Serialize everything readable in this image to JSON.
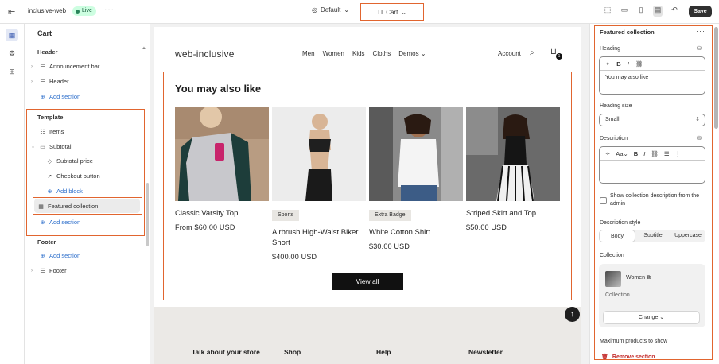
{
  "topbar": {
    "store_name": "inclusive-web",
    "live_label": "Live",
    "theme_label": "Default",
    "page_label": "Cart",
    "save_label": "Save"
  },
  "left_panel": {
    "title": "Cart",
    "header_group": "Header",
    "announcement_bar": "Announcement bar",
    "header_item": "Header",
    "add_section": "Add section",
    "template_group": "Template",
    "items": "Items",
    "subtotal": "Subtotal",
    "subtotal_price": "Subtotal price",
    "checkout_button": "Checkout button",
    "add_block": "Add block",
    "featured_collection": "Featured collection",
    "footer_group": "Footer",
    "footer_item": "Footer"
  },
  "storefront": {
    "logo": "web-inclusive",
    "nav": [
      "Men",
      "Women",
      "Kids",
      "Cloths",
      "Demos"
    ],
    "account": "Account",
    "cart_count": "1",
    "section_heading": "You may also like",
    "products": [
      {
        "name": "Classic Varsity Top",
        "price": "From $60.00 USD",
        "tag": ""
      },
      {
        "name": "Airbrush High-Waist Biker Short",
        "price": "$400.00 USD",
        "tag": "Sports"
      },
      {
        "name": "White Cotton Shirt",
        "price": "$30.00 USD",
        "tag": "Extra Badge"
      },
      {
        "name": "Striped Skirt and Top",
        "price": "$50.00 USD",
        "tag": ""
      }
    ],
    "view_all": "View all",
    "footer_columns": [
      "Talk about your store",
      "Shop",
      "Help",
      "Newsletter"
    ]
  },
  "right_panel": {
    "title": "Featured collection",
    "heading_label": "Heading",
    "heading_value": "You may also  like",
    "heading_size_label": "Heading size",
    "heading_size_value": "Small",
    "description_label": "Description",
    "show_desc_label": "Show collection description from the admin",
    "desc_style_label": "Description style",
    "desc_style_options": [
      "Body",
      "Subtitle",
      "Uppercase"
    ],
    "collection_label": "Collection",
    "collection_name": "Women",
    "collection_sub": "Collection",
    "change_label": "Change",
    "max_products_label": "Maximum products to show",
    "remove_label": "Remove section"
  },
  "colors": {
    "highlight": "#e1652f",
    "link": "#2c6ecb",
    "live_bg": "#cdfee1",
    "danger": "#c53030"
  }
}
